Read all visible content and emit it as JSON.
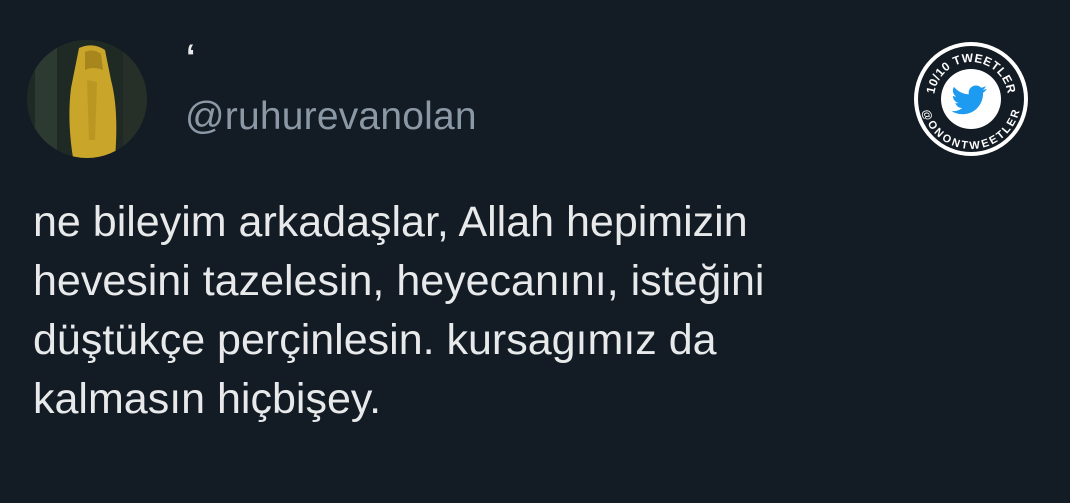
{
  "tweet": {
    "display_name": "‘",
    "handle": "@ruhurevanolan",
    "text": "ne bileyim arkadaşlar, Allah hepimizin\nhevesini tazelesin, heyecanını, isteğini\ndüştükçe perçinlesin. kursagımız da\nkalmasın hiçbişey."
  },
  "watermark": {
    "top_text": "10/10 TWEETLER",
    "bottom_text": "@ONONTWEETLER",
    "icon": "twitter-bird-icon",
    "colors": {
      "ring": "#ffffff",
      "fill": "#131b24",
      "bird": "#1d9bf0"
    }
  },
  "avatar": {
    "icon": "profile-photo",
    "accent": "#c9a52a"
  }
}
